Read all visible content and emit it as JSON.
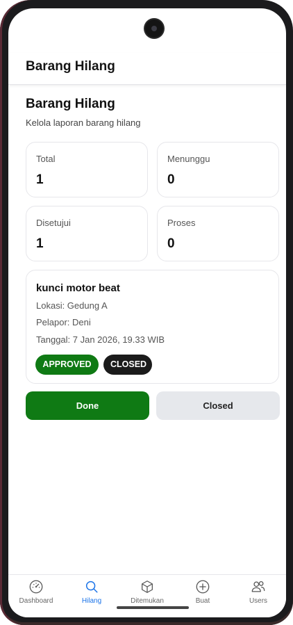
{
  "app_bar": {
    "title": "Barang Hilang"
  },
  "page": {
    "title": "Barang Hilang",
    "subtitle": "Kelola laporan barang hilang"
  },
  "stats": [
    {
      "label": "Total",
      "value": "1"
    },
    {
      "label": "Menunggu",
      "value": "0"
    },
    {
      "label": "Disetujui",
      "value": "1"
    },
    {
      "label": "Proses",
      "value": "0"
    }
  ],
  "item": {
    "title": "kunci motor beat",
    "location": "Lokasi: Gedung A",
    "reporter": "Pelapor: Deni",
    "date": "Tanggal: 7 Jan 2026, 19.33 WIB",
    "badges": [
      "APPROVED",
      "CLOSED"
    ]
  },
  "actions": {
    "done_label": "Done",
    "closed_label": "Closed"
  },
  "nav": {
    "items": [
      {
        "label": "Dashboard",
        "icon": "dashboard-gauge-icon"
      },
      {
        "label": "Hilang",
        "icon": "search-icon"
      },
      {
        "label": "Ditemukan",
        "icon": "box-icon"
      },
      {
        "label": "Buat",
        "icon": "plus-circle-icon"
      },
      {
        "label": "Users",
        "icon": "users-icon"
      }
    ],
    "active_index": 1
  },
  "colors": {
    "primary_green": "#0f7a14",
    "badge_dark": "#1b1b1b",
    "active_nav": "#1a73e8",
    "secondary_button": "#e6e8ec"
  }
}
